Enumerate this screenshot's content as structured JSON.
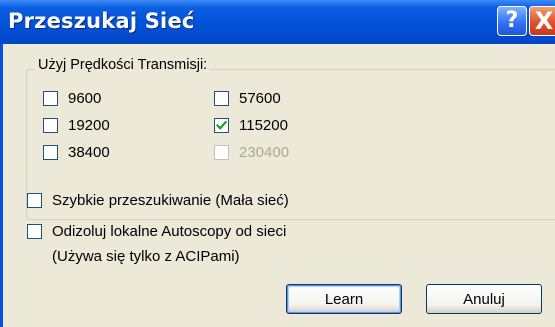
{
  "window": {
    "title": "Przeszukaj Sieć",
    "help_glyph": "?",
    "close_glyph": "X"
  },
  "speed_group": {
    "label": "Użyj Prędkości Transmisji:",
    "options": [
      {
        "label": "9600",
        "checked": false,
        "enabled": true
      },
      {
        "label": "19200",
        "checked": false,
        "enabled": true
      },
      {
        "label": "38400",
        "checked": false,
        "enabled": true
      },
      {
        "label": "57600",
        "checked": false,
        "enabled": true
      },
      {
        "label": "115200",
        "checked": true,
        "enabled": true
      },
      {
        "label": "230400",
        "checked": false,
        "enabled": false
      }
    ]
  },
  "options": {
    "fast_scan": {
      "label": "Szybkie przeszukiwanie (Mała sieć)",
      "checked": false
    },
    "isolate": {
      "label": "Odizoluj lokalne Autoscopy od sieci",
      "checked": false
    },
    "isolate_note": "(Używa się tylko z ACIPami)"
  },
  "buttons": {
    "learn": "Learn",
    "cancel": "Anuluj"
  },
  "colors": {
    "titlebar": "#0352d8",
    "dialog_bg": "#ece9d8",
    "disabled_text": "#aca899"
  }
}
